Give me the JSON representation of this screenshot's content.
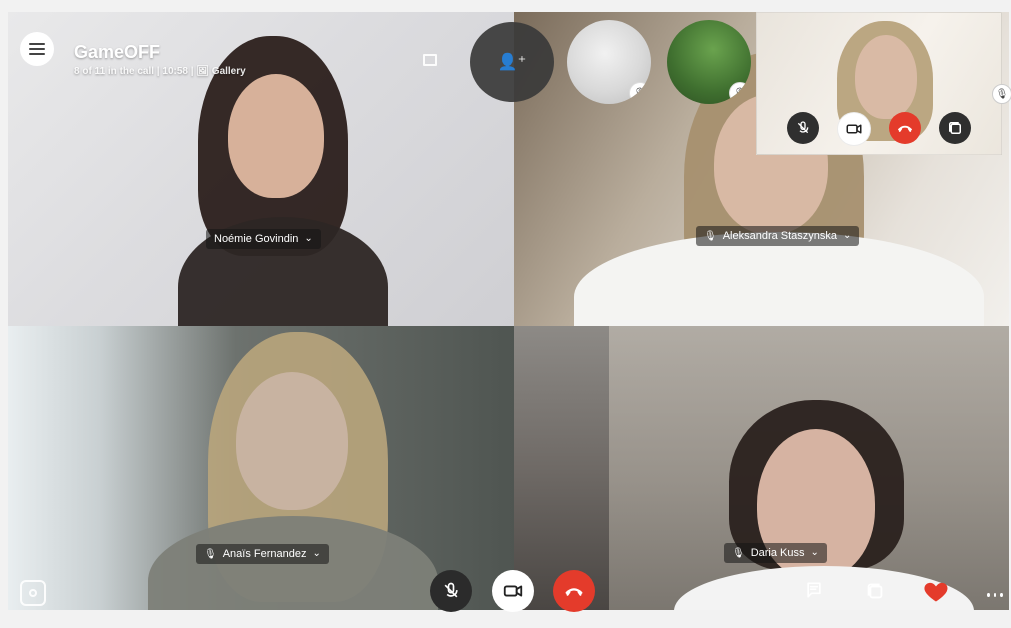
{
  "call": {
    "title": "GameOFF",
    "subtitle": "8 of 11 in the call | 10:58 | 🖼 Gallery"
  },
  "participants": [
    {
      "name": "Noémie Govindin",
      "muted": false
    },
    {
      "name": "Aleksandra Staszynska",
      "muted": true
    },
    {
      "name": "Anaïs Fernandez",
      "muted": true
    },
    {
      "name": "Daria Kuss",
      "muted": true
    }
  ],
  "icons": {
    "menu": "menu-icon",
    "fullscreen": "fullscreen-icon",
    "add_participant": "add-person-icon",
    "mute": "mic-muted-icon",
    "camera": "camera-icon",
    "end_call": "end-call-icon",
    "switch_layout": "layout-icon",
    "screenshot": "screenshot-icon",
    "chat": "chat-icon",
    "reaction": "heart-icon",
    "more": "more-icon"
  },
  "colors": {
    "end_call_red": "#e43b2b",
    "heart_red": "#e43b2b"
  }
}
